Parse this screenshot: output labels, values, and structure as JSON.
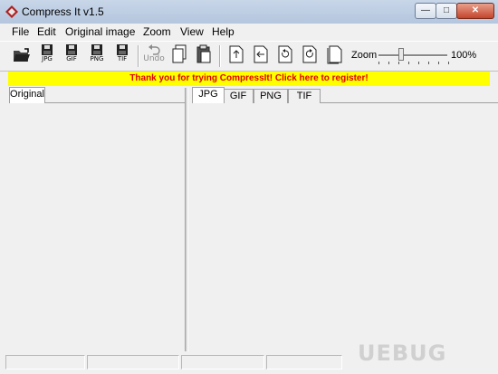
{
  "window": {
    "title": "Compress It v1.5",
    "controls": {
      "minimize": "—",
      "maximize": "□",
      "close": "✕"
    }
  },
  "menu": [
    "File",
    "Edit",
    "Original image",
    "Zoom",
    "View",
    "Help"
  ],
  "toolbar": {
    "save_captions": [
      "JPG",
      "GIF",
      "PNG",
      "TIF"
    ],
    "undo_label": "Undo",
    "zoom_label": "Zoom",
    "zoom_value": "100%"
  },
  "banner": {
    "text": "Thank you for trying CompressIt! Click here to register!",
    "bg_color": "#ffff00",
    "text_color": "#e00000"
  },
  "left_panel": {
    "tab": "Original"
  },
  "right_panel": {
    "tabs": [
      "JPG",
      "GIF",
      "PNG",
      "TIF"
    ],
    "active_tab": "JPG"
  },
  "watermark": "UEBUG"
}
